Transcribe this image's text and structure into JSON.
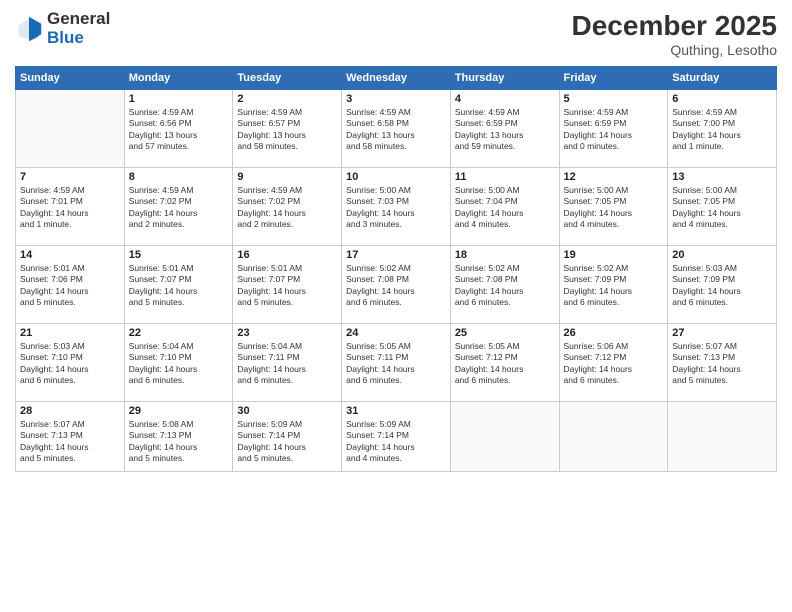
{
  "logo": {
    "line1": "General",
    "line2": "Blue"
  },
  "title": "December 2025",
  "subtitle": "Quthing, Lesotho",
  "days_header": [
    "Sunday",
    "Monday",
    "Tuesday",
    "Wednesday",
    "Thursday",
    "Friday",
    "Saturday"
  ],
  "weeks": [
    [
      {
        "num": "",
        "info": ""
      },
      {
        "num": "1",
        "info": "Sunrise: 4:59 AM\nSunset: 6:56 PM\nDaylight: 13 hours\nand 57 minutes."
      },
      {
        "num": "2",
        "info": "Sunrise: 4:59 AM\nSunset: 6:57 PM\nDaylight: 13 hours\nand 58 minutes."
      },
      {
        "num": "3",
        "info": "Sunrise: 4:59 AM\nSunset: 6:58 PM\nDaylight: 13 hours\nand 58 minutes."
      },
      {
        "num": "4",
        "info": "Sunrise: 4:59 AM\nSunset: 6:59 PM\nDaylight: 13 hours\nand 59 minutes."
      },
      {
        "num": "5",
        "info": "Sunrise: 4:59 AM\nSunset: 6:59 PM\nDaylight: 14 hours\nand 0 minutes."
      },
      {
        "num": "6",
        "info": "Sunrise: 4:59 AM\nSunset: 7:00 PM\nDaylight: 14 hours\nand 1 minute."
      }
    ],
    [
      {
        "num": "7",
        "info": "Sunrise: 4:59 AM\nSunset: 7:01 PM\nDaylight: 14 hours\nand 1 minute."
      },
      {
        "num": "8",
        "info": "Sunrise: 4:59 AM\nSunset: 7:02 PM\nDaylight: 14 hours\nand 2 minutes."
      },
      {
        "num": "9",
        "info": "Sunrise: 4:59 AM\nSunset: 7:02 PM\nDaylight: 14 hours\nand 2 minutes."
      },
      {
        "num": "10",
        "info": "Sunrise: 5:00 AM\nSunset: 7:03 PM\nDaylight: 14 hours\nand 3 minutes."
      },
      {
        "num": "11",
        "info": "Sunrise: 5:00 AM\nSunset: 7:04 PM\nDaylight: 14 hours\nand 4 minutes."
      },
      {
        "num": "12",
        "info": "Sunrise: 5:00 AM\nSunset: 7:05 PM\nDaylight: 14 hours\nand 4 minutes."
      },
      {
        "num": "13",
        "info": "Sunrise: 5:00 AM\nSunset: 7:05 PM\nDaylight: 14 hours\nand 4 minutes."
      }
    ],
    [
      {
        "num": "14",
        "info": "Sunrise: 5:01 AM\nSunset: 7:06 PM\nDaylight: 14 hours\nand 5 minutes."
      },
      {
        "num": "15",
        "info": "Sunrise: 5:01 AM\nSunset: 7:07 PM\nDaylight: 14 hours\nand 5 minutes."
      },
      {
        "num": "16",
        "info": "Sunrise: 5:01 AM\nSunset: 7:07 PM\nDaylight: 14 hours\nand 5 minutes."
      },
      {
        "num": "17",
        "info": "Sunrise: 5:02 AM\nSunset: 7:08 PM\nDaylight: 14 hours\nand 6 minutes."
      },
      {
        "num": "18",
        "info": "Sunrise: 5:02 AM\nSunset: 7:08 PM\nDaylight: 14 hours\nand 6 minutes."
      },
      {
        "num": "19",
        "info": "Sunrise: 5:02 AM\nSunset: 7:09 PM\nDaylight: 14 hours\nand 6 minutes."
      },
      {
        "num": "20",
        "info": "Sunrise: 5:03 AM\nSunset: 7:09 PM\nDaylight: 14 hours\nand 6 minutes."
      }
    ],
    [
      {
        "num": "21",
        "info": "Sunrise: 5:03 AM\nSunset: 7:10 PM\nDaylight: 14 hours\nand 6 minutes."
      },
      {
        "num": "22",
        "info": "Sunrise: 5:04 AM\nSunset: 7:10 PM\nDaylight: 14 hours\nand 6 minutes."
      },
      {
        "num": "23",
        "info": "Sunrise: 5:04 AM\nSunset: 7:11 PM\nDaylight: 14 hours\nand 6 minutes."
      },
      {
        "num": "24",
        "info": "Sunrise: 5:05 AM\nSunset: 7:11 PM\nDaylight: 14 hours\nand 6 minutes."
      },
      {
        "num": "25",
        "info": "Sunrise: 5:05 AM\nSunset: 7:12 PM\nDaylight: 14 hours\nand 6 minutes."
      },
      {
        "num": "26",
        "info": "Sunrise: 5:06 AM\nSunset: 7:12 PM\nDaylight: 14 hours\nand 6 minutes."
      },
      {
        "num": "27",
        "info": "Sunrise: 5:07 AM\nSunset: 7:13 PM\nDaylight: 14 hours\nand 5 minutes."
      }
    ],
    [
      {
        "num": "28",
        "info": "Sunrise: 5:07 AM\nSunset: 7:13 PM\nDaylight: 14 hours\nand 5 minutes."
      },
      {
        "num": "29",
        "info": "Sunrise: 5:08 AM\nSunset: 7:13 PM\nDaylight: 14 hours\nand 5 minutes."
      },
      {
        "num": "30",
        "info": "Sunrise: 5:09 AM\nSunset: 7:14 PM\nDaylight: 14 hours\nand 5 minutes."
      },
      {
        "num": "31",
        "info": "Sunrise: 5:09 AM\nSunset: 7:14 PM\nDaylight: 14 hours\nand 4 minutes."
      },
      {
        "num": "",
        "info": ""
      },
      {
        "num": "",
        "info": ""
      },
      {
        "num": "",
        "info": ""
      }
    ]
  ]
}
